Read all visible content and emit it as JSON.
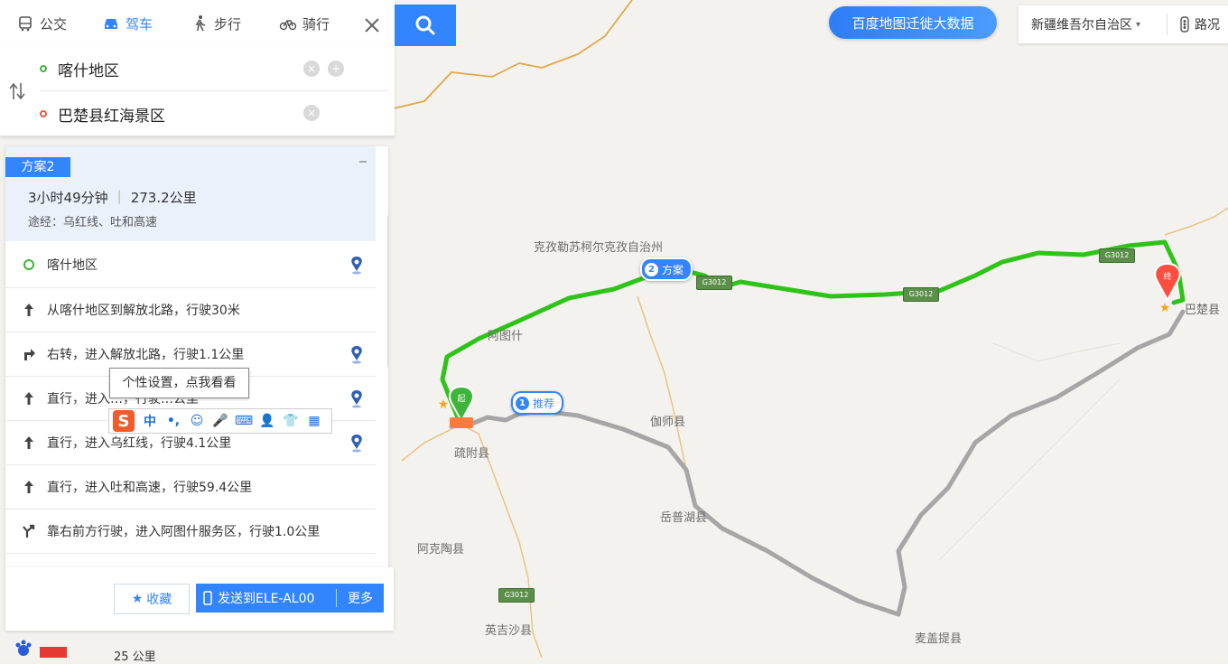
{
  "modes": [
    {
      "label": "公交",
      "icon": "bus-icon",
      "active": false
    },
    {
      "label": "驾车",
      "icon": "car-icon",
      "active": true
    },
    {
      "label": "步行",
      "icon": "walk-icon",
      "active": false
    },
    {
      "label": "骑行",
      "icon": "bike-icon",
      "active": false
    }
  ],
  "route_input": {
    "origin": "喀什地区",
    "destination": "巴楚县红海景区"
  },
  "banner": "百度地图迁徙大数据",
  "region": "新疆维吾尔自治区",
  "traffic_label": "路况",
  "plan": {
    "tag": "方案2",
    "duration": "3小时49分钟",
    "distance": "273.2公里",
    "via": "途经：乌红线、吐和高速"
  },
  "steps": [
    {
      "text": "喀什地区",
      "icon": "start-dot-icon",
      "pin": true
    },
    {
      "text": "从喀什地区到解放北路，行驶30米",
      "icon": "arrow-up-icon",
      "pin": false
    },
    {
      "text": "右转，进入解放北路，行驶1.1公里",
      "icon": "turn-right-icon",
      "pin": true
    },
    {
      "text": "直行，进入…，行驶…公里",
      "icon": "arrow-up-icon",
      "pin": true
    },
    {
      "text": "直行，进入乌红线，行驶4.1公里",
      "icon": "arrow-up-icon",
      "pin": true
    },
    {
      "text": "直行，进入吐和高速，行驶59.4公里",
      "icon": "arrow-up-icon",
      "pin": false
    },
    {
      "text": "靠右前方行驶，进入阿图什服务区，行驶1.0公里",
      "icon": "fork-right-icon",
      "pin": false
    }
  ],
  "tooltip": "个性设置，点我看看",
  "ime": {
    "logo": "S",
    "items": [
      "中",
      "•,",
      "☺",
      "🎤",
      "⌨",
      "👤",
      "👕",
      "▦"
    ]
  },
  "footer": {
    "favorite": "收藏",
    "send": "发送到ELE-AL00",
    "more": "更多"
  },
  "scale": "25 公里",
  "map": {
    "labels": [
      {
        "text": "克孜勒苏柯尔克孜自治州",
        "name": "label-kizilsu"
      },
      {
        "text": "阿图什",
        "name": "label-atushi"
      },
      {
        "text": "伽师县",
        "name": "label-jiashi"
      },
      {
        "text": "岳普湖县",
        "name": "label-yuepuhu"
      },
      {
        "text": "疏附县",
        "name": "label-shufu"
      },
      {
        "text": "阿克陶县",
        "name": "label-aketao"
      },
      {
        "text": "英吉沙县",
        "name": "label-yingjisha"
      },
      {
        "text": "麦盖提县",
        "name": "label-maigaiti"
      },
      {
        "text": "巴楚县",
        "name": "label-bachu"
      }
    ],
    "markers": {
      "plan2": {
        "num": "2",
        "label": "方案"
      },
      "plan1": {
        "num": "1",
        "label": "推荐"
      },
      "start": "起",
      "end": "终"
    },
    "colors": {
      "route_main": "#2ec319",
      "route_alt": "#a6a6a6",
      "boundary": "#e0a84a",
      "accent": "#3385ff"
    }
  }
}
